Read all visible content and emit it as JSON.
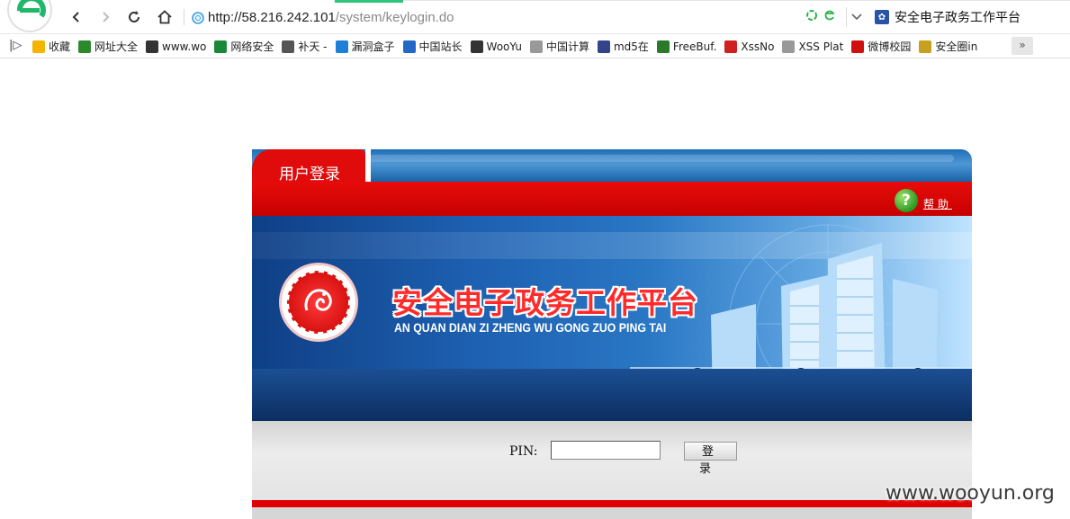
{
  "browser": {
    "url_host": "http://58.216.242.101",
    "url_path": "/system/keylogin.do",
    "site_title": "安全电子政务工作平台"
  },
  "bookmarks": [
    {
      "label": "收藏",
      "icon": "star-icon",
      "color": "#f5b400"
    },
    {
      "label": "网址大全",
      "icon": "globe-icon",
      "color": "#2c8a2c"
    },
    {
      "label": "www.wo",
      "icon": "wooyun-icon",
      "color": "#333333"
    },
    {
      "label": "网络安全",
      "icon": "l-icon",
      "color": "#1a8a3a"
    },
    {
      "label": "补天 -",
      "icon": "star-outline-icon",
      "color": "#555555"
    },
    {
      "label": "漏洞盒子",
      "icon": "hexagon-icon",
      "color": "#1e7fd6"
    },
    {
      "label": "中国站长",
      "icon": "chart-icon",
      "color": "#2468c7"
    },
    {
      "label": "WooYu",
      "icon": "wooyun-icon",
      "color": "#333333"
    },
    {
      "label": "中国计算",
      "icon": "page-icon",
      "color": "#999999"
    },
    {
      "label": "md5在",
      "icon": "grid-icon",
      "color": "#334488"
    },
    {
      "label": "FreeBuf.",
      "icon": "f-icon",
      "color": "#2b7a2b"
    },
    {
      "label": "XssNo",
      "icon": "xss-icon",
      "color": "#d02020"
    },
    {
      "label": "XSS Plat",
      "icon": "page-icon",
      "color": "#999999"
    },
    {
      "label": "微博校园",
      "icon": "m-icon",
      "color": "#d01010"
    },
    {
      "label": "安全圈in",
      "icon": "circle-icon",
      "color": "#c8a020"
    }
  ],
  "bookmarks_more": "»",
  "panel": {
    "tab_label": "用户登录",
    "help_label": "帮助",
    "system_title": "安全电子政务工作平台",
    "system_pinyin": "AN QUAN DIAN ZI ZHENG WU GONG ZUO PING TAI",
    "pin_label": "PIN:",
    "pin_value": "",
    "login_button": "登 录"
  },
  "watermark": "www.wooyun.org",
  "colors": {
    "brand_red": "#e00b0b",
    "brand_blue": "#1f6fb6"
  }
}
